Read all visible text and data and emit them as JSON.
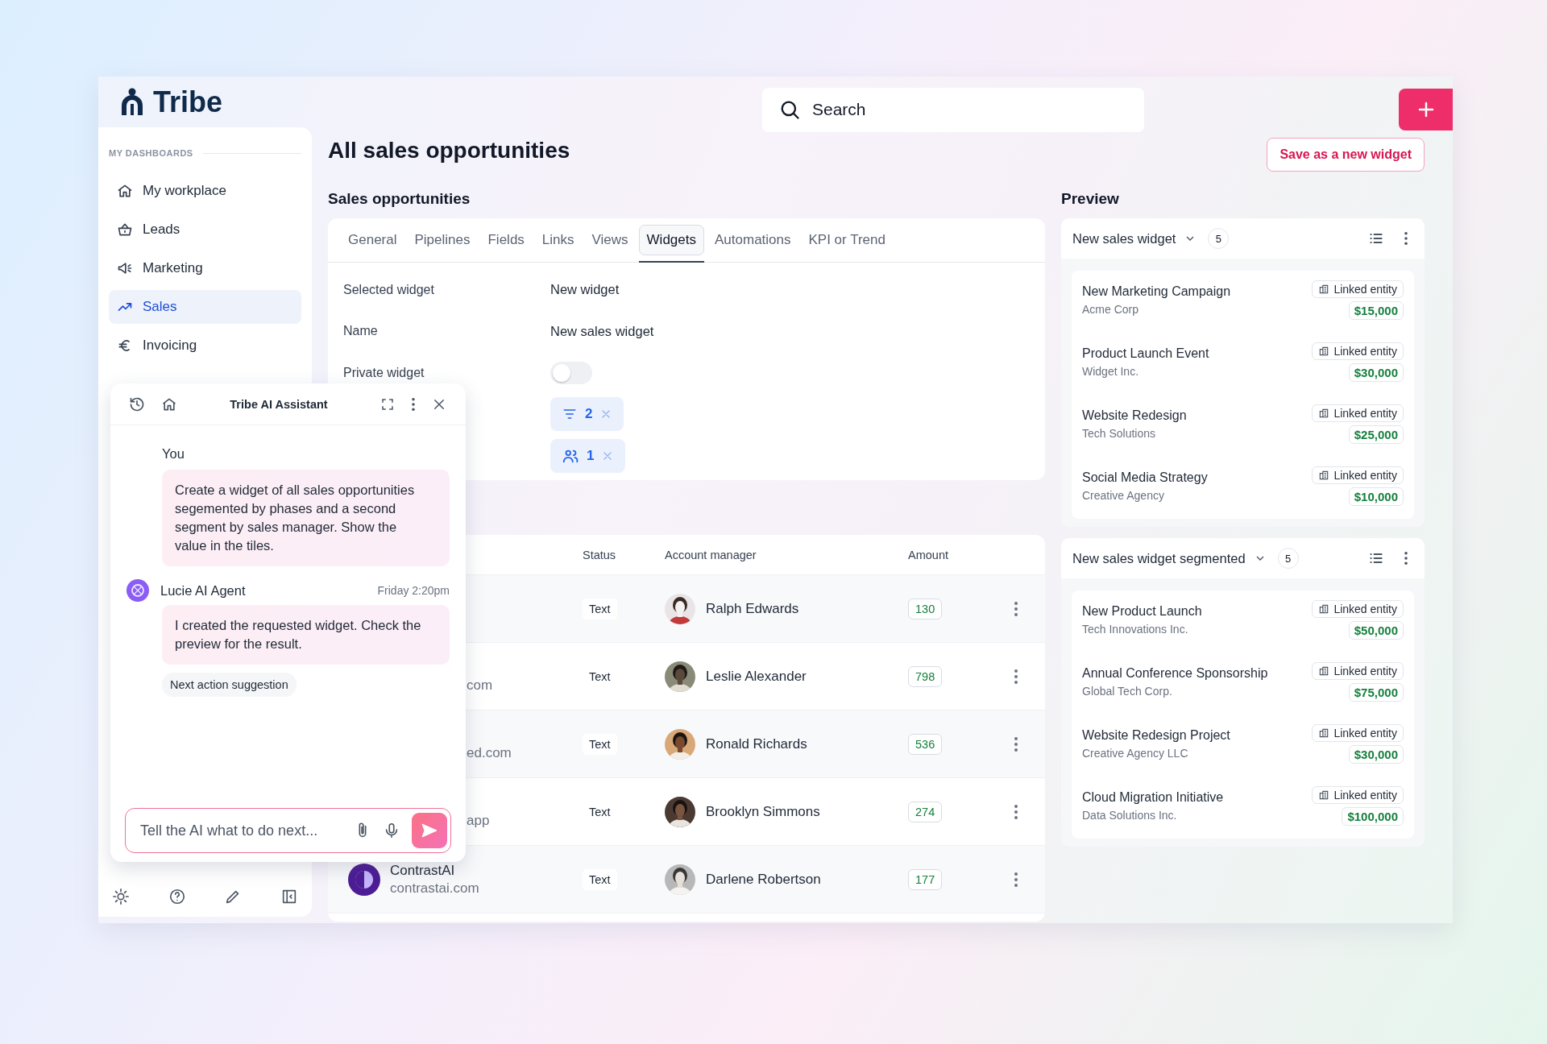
{
  "brand": {
    "name": "Tribe"
  },
  "search": {
    "placeholder": "Search"
  },
  "sidebar": {
    "section": "MY DASHBOARDS",
    "items": [
      {
        "label": "My workplace",
        "selected": false
      },
      {
        "label": "Leads",
        "selected": false
      },
      {
        "label": "Marketing",
        "selected": false
      },
      {
        "label": "Sales",
        "selected": true
      },
      {
        "label": "Invoicing",
        "selected": false
      }
    ]
  },
  "page": {
    "title": "All sales opportunities",
    "save_button": "Save as a new widget"
  },
  "settings": {
    "heading": "Sales opportunities",
    "tabs": [
      {
        "label": "General",
        "selected": false
      },
      {
        "label": "Pipelines",
        "selected": false
      },
      {
        "label": "Fields",
        "selected": false
      },
      {
        "label": "Links",
        "selected": false
      },
      {
        "label": "Views",
        "selected": false
      },
      {
        "label": "Widgets",
        "selected": true
      },
      {
        "label": "Automations",
        "selected": false
      },
      {
        "label": "KPI or Trend",
        "selected": false
      }
    ],
    "fields": [
      {
        "kind": "text",
        "label": "Selected widget",
        "value": "New widget"
      },
      {
        "kind": "text",
        "label": "Name",
        "value": "New sales widget"
      },
      {
        "kind": "toggle",
        "label": "Private widget",
        "on": false
      },
      {
        "kind": "filter-chip",
        "count": "2"
      },
      {
        "kind": "people-chip",
        "count": "1"
      }
    ]
  },
  "table": {
    "columns": [
      "Status",
      "Account manager",
      "Amount"
    ],
    "rows": [
      {
        "status": "Text",
        "manager": "Ralph Edwards",
        "amount": "130"
      },
      {
        "domain": "com",
        "status": "Text",
        "manager": "Leslie Alexander",
        "amount": "798"
      },
      {
        "domain": "ed.com",
        "status": "Text",
        "manager": "Ronald Richards",
        "amount": "536"
      },
      {
        "domain": "app",
        "status": "Text",
        "manager": "Brooklyn Simmons",
        "amount": "274"
      },
      {
        "company": "ContrastAI",
        "domain": "contrastai.com",
        "status": "Text",
        "manager": "Darlene Robertson",
        "amount": "177"
      }
    ]
  },
  "preview": {
    "title": "Preview",
    "widgets": [
      {
        "title": "New sales widget",
        "count": "5",
        "items": [
          {
            "name": "New Marketing Campaign",
            "company": "Acme Corp",
            "tag": "Linked entity",
            "amount": "$15,000"
          },
          {
            "name": "Product Launch Event",
            "company": "Widget Inc.",
            "tag": "Linked entity",
            "amount": "$30,000"
          },
          {
            "name": "Website Redesign",
            "company": "Tech Solutions",
            "tag": "Linked entity",
            "amount": "$25,000"
          },
          {
            "name": "Social Media Strategy",
            "company": "Creative Agency",
            "tag": "Linked entity",
            "amount": "$10,000"
          }
        ]
      },
      {
        "title": "New sales widget segmented",
        "count": "5",
        "items": [
          {
            "name": "New Product Launch",
            "company": "Tech Innovations Inc.",
            "tag": "Linked entity",
            "amount": "$50,000"
          },
          {
            "name": "Annual Conference Sponsorship",
            "company": "Global Tech Corp.",
            "tag": "Linked entity",
            "amount": "$75,000"
          },
          {
            "name": "Website Redesign Project",
            "company": "Creative Agency LLC",
            "tag": "Linked entity",
            "amount": "$30,000"
          },
          {
            "name": "Cloud Migration Initiative",
            "company": "Data Solutions Inc.",
            "tag": "Linked entity",
            "amount": "$100,000"
          }
        ]
      }
    ]
  },
  "chat": {
    "title": "Tribe AI Assistant",
    "messages": [
      {
        "kind": "user",
        "author": "You",
        "text": "Create a widget of all sales opportunities segemented by phases and a second segment by sales manager. Show the value in the tiles."
      },
      {
        "kind": "agent",
        "author": "Lucie AI Agent",
        "time": "Friday 2:20pm",
        "text": "I created the requested widget. Check the preview for the result."
      }
    ],
    "suggestion": "Next action suggestion",
    "input": {
      "placeholder": "Tell the AI what to do next..."
    }
  }
}
